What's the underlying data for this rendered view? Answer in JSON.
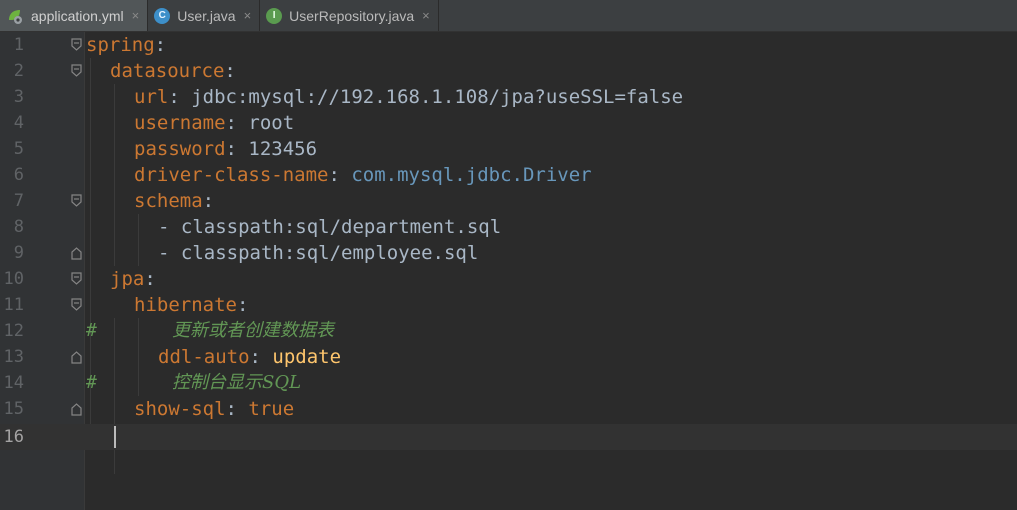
{
  "tabs": [
    {
      "label": "application.yml",
      "icon": "spring-yaml-icon",
      "active": true
    },
    {
      "label": "User.java",
      "icon": "class-icon",
      "badge": "C",
      "active": false
    },
    {
      "label": "UserRepository.java",
      "icon": "interface-icon",
      "badge": "I",
      "active": false
    }
  ],
  "close_glyph": "×",
  "lines": [
    {
      "num": "1",
      "t": [
        "spring",
        ":"
      ]
    },
    {
      "num": "2",
      "t": [
        "datasource",
        ":"
      ]
    },
    {
      "num": "3",
      "t": [
        "url",
        ": ",
        "jdbc:mysql://192.168.1.108/jpa?useSSL=false"
      ]
    },
    {
      "num": "4",
      "t": [
        "username",
        ": ",
        "root"
      ]
    },
    {
      "num": "5",
      "t": [
        "password",
        ": ",
        "123456"
      ]
    },
    {
      "num": "6",
      "t": [
        "driver-class-name",
        ": ",
        "com.mysql.jdbc.",
        "Driver"
      ]
    },
    {
      "num": "7",
      "t": [
        "schema",
        ":"
      ]
    },
    {
      "num": "8",
      "t": [
        "- classpath:sql/department.sql"
      ]
    },
    {
      "num": "9",
      "t": [
        "- classpath:sql/employee.sql"
      ]
    },
    {
      "num": "10",
      "t": [
        "jpa",
        ":"
      ]
    },
    {
      "num": "11",
      "t": [
        "hibernate",
        ":"
      ]
    },
    {
      "num": "12",
      "hash": "#",
      "comment": "更新或者创建数据表"
    },
    {
      "num": "13",
      "t": [
        "ddl-auto",
        ": ",
        "update"
      ]
    },
    {
      "num": "14",
      "hash": "#",
      "comment": "控制台显示SQL"
    },
    {
      "num": "15",
      "t": [
        "show-sql",
        ": ",
        "true"
      ]
    },
    {
      "num": "16",
      "t": []
    }
  ],
  "colors": {
    "background": "#2b2b2b",
    "gutter": "#313335",
    "key": "#cc7832",
    "text": "#a9b7c6",
    "package": "#6897bb",
    "string_value": "#ffc66d",
    "comment": "#629755",
    "line_number": "#606366"
  }
}
